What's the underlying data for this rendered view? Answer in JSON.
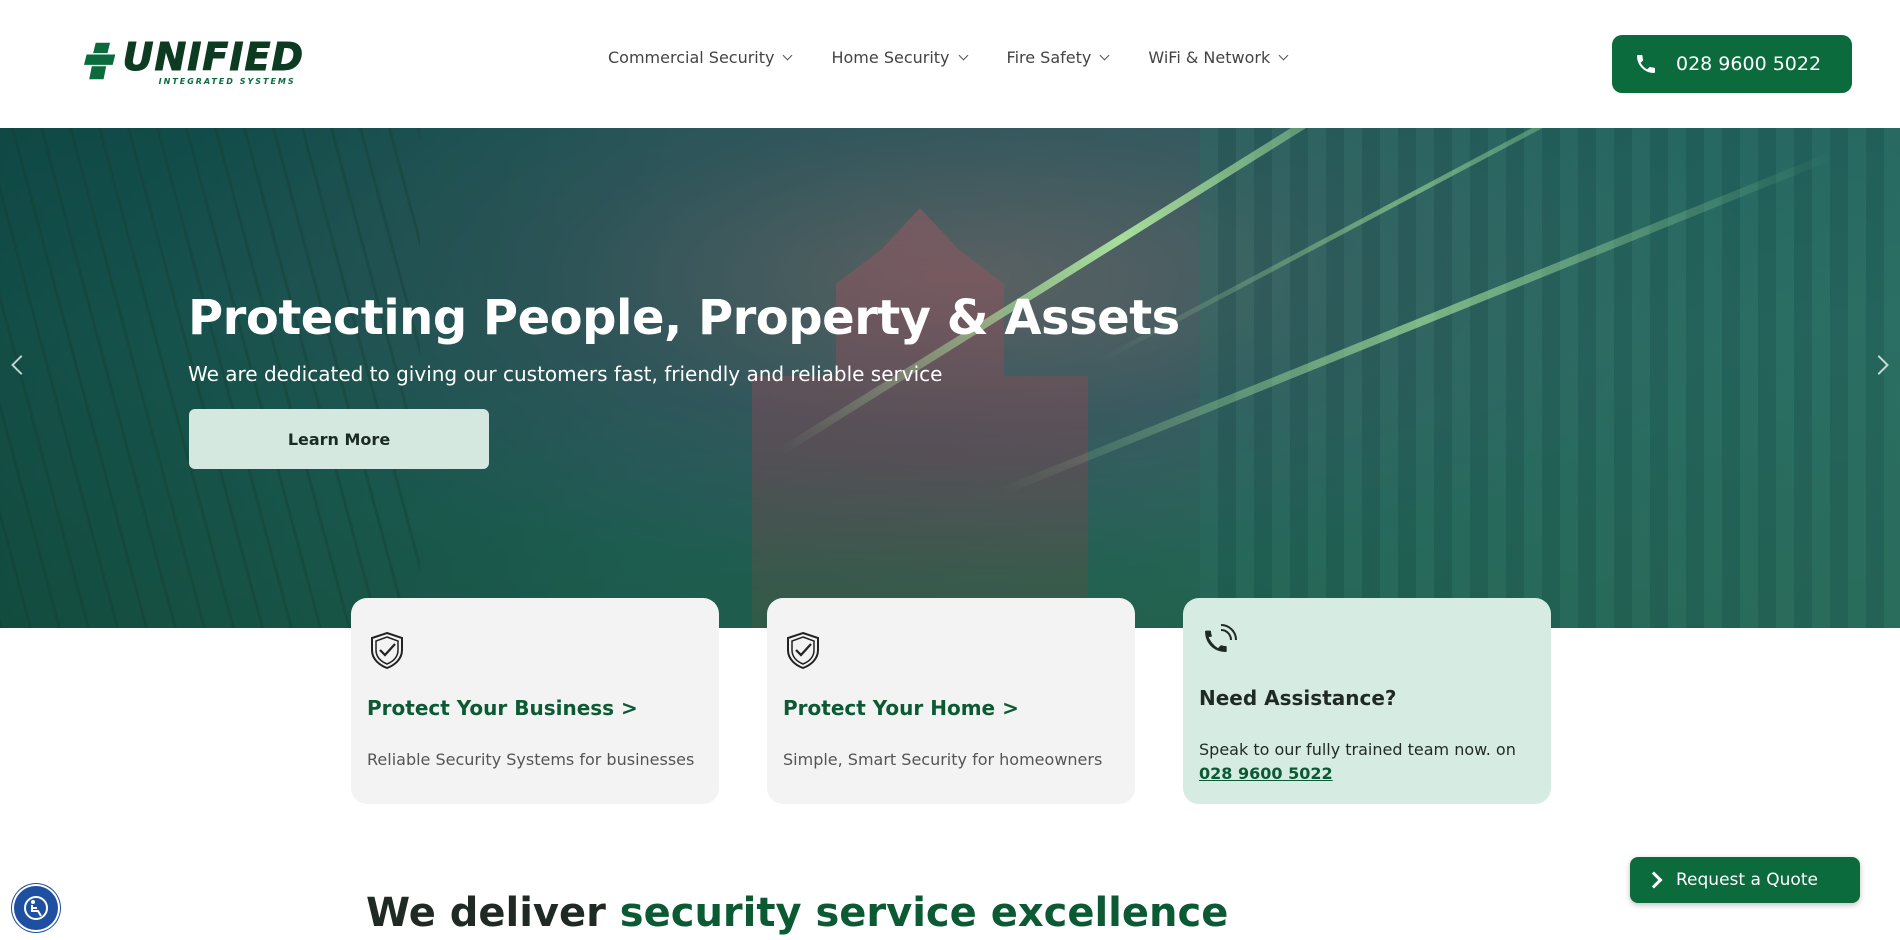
{
  "header": {
    "logo": {
      "wordmark": "UNIFIED",
      "tagline": "INTEGRATED SYSTEMS"
    },
    "nav": [
      {
        "label": "Commercial Security",
        "icon": "chevron-down-icon"
      },
      {
        "label": "Home Security",
        "icon": "chevron-down-icon"
      },
      {
        "label": "Fire Safety",
        "icon": "chevron-down-icon"
      },
      {
        "label": "WiFi & Network",
        "icon": "chevron-down-icon"
      }
    ],
    "phone_button": {
      "icon": "phone-icon",
      "label": "028 9600 5022"
    }
  },
  "hero": {
    "title": "Protecting People, Property & Assets",
    "subtitle": "We are dedicated to giving our customers fast, friendly and reliable service",
    "cta_label": "Learn More"
  },
  "cards": [
    {
      "icon": "shield-check-icon",
      "title": "Protect Your Business >",
      "description": "Reliable Security Systems for businesses"
    },
    {
      "icon": "shield-check-icon",
      "title": "Protect Your Home >",
      "description": "Simple, Smart Security for homeowners"
    },
    {
      "icon": "phone-ringing-icon",
      "title": "Need Assistance?",
      "description": "Speak to our fully trained team now. on",
      "phone": "028 9600 5022"
    }
  ],
  "section": {
    "heading_plain": "We deliver ",
    "heading_bold": "security service excellence"
  },
  "floating": {
    "quote_label": "Request a Quote",
    "accessibility_icon": "accessibility-icon"
  },
  "colors": {
    "brand_green": "#0b6b3d",
    "dark_green": "#0b5a34",
    "mint": "#d6ebe2",
    "card_gray": "#f3f3f3"
  }
}
